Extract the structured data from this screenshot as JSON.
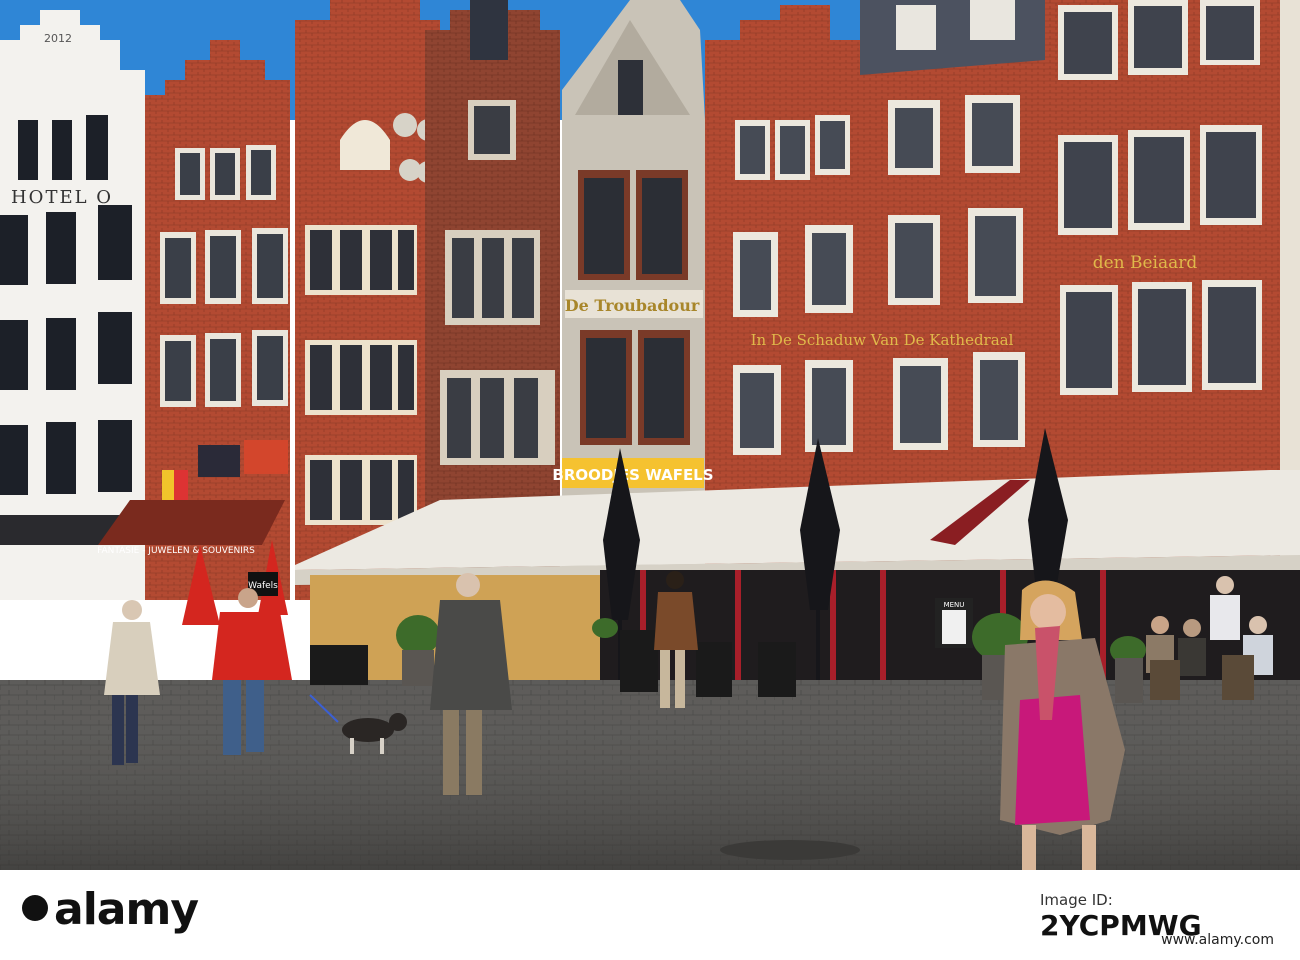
{
  "photo": {
    "signs": {
      "year": "2012",
      "hotel": "HOTEL O",
      "troubadour": "De Troubadour",
      "kathedraal": "In De Schaduw Van De Kathedraal",
      "beiaard": "den Beiaard",
      "broodjes_wafels": "BROODJES WAFELS",
      "fantasie": "FANTASIE - JUWELEN & SOUVENIRS",
      "wafels_board": "Wafels",
      "menu_board": "MENU"
    },
    "colors": {
      "sky": "#2f86d6",
      "brick_red": "#b34a32",
      "brick_dark": "#7e3a28",
      "white_facade": "#f3f2ee",
      "awning": "#ece9e2",
      "umbrella": "#16161a",
      "cobblestone": "#5b5a58",
      "red_jacket": "#d4261f",
      "magenta_dress": "#c8187a"
    }
  },
  "stock": {
    "logo": "alamy",
    "id_label": "Image ID:",
    "image_id": "2YCPMWG",
    "url": "www.alamy.com"
  }
}
